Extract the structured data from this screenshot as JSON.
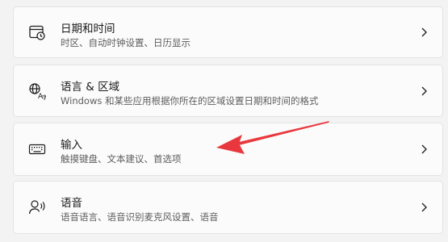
{
  "settings": {
    "items": [
      {
        "icon": "calendar-clock-icon",
        "title": "日期和时间",
        "subtitle": "时区、自动时钟设置、日历显示"
      },
      {
        "icon": "language-region-icon",
        "title": "语言 & 区域",
        "subtitle": "Windows 和某些应用根据你所在的区域设置日期和时间的格式"
      },
      {
        "icon": "keyboard-icon",
        "title": "输入",
        "subtitle": "触摸键盘、文本建议、首选项"
      },
      {
        "icon": "speech-icon",
        "title": "语音",
        "subtitle": "语音语言、语音识别麦克风设置、语音"
      }
    ]
  },
  "annotation": {
    "color": "#e8383d",
    "points_to": "输入"
  }
}
